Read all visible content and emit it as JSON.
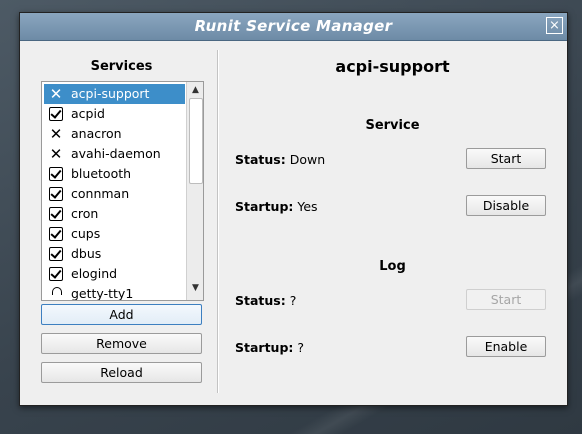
{
  "window": {
    "title": "Runit Service Manager",
    "close_glyph": "⨯"
  },
  "left": {
    "heading": "Services",
    "items": [
      {
        "label": "acpi-support",
        "state": "disabled",
        "selected": true
      },
      {
        "label": "acpid",
        "state": "enabled"
      },
      {
        "label": "anacron",
        "state": "disabled"
      },
      {
        "label": "avahi-daemon",
        "state": "disabled"
      },
      {
        "label": "bluetooth",
        "state": "enabled"
      },
      {
        "label": "connman",
        "state": "enabled"
      },
      {
        "label": "cron",
        "state": "enabled"
      },
      {
        "label": "cups",
        "state": "enabled"
      },
      {
        "label": "dbus",
        "state": "enabled"
      },
      {
        "label": "elogind",
        "state": "enabled"
      },
      {
        "label": "getty-tty1",
        "state": "locked"
      }
    ],
    "buttons": {
      "add": "Add",
      "remove": "Remove",
      "reload": "Reload"
    }
  },
  "detail": {
    "service_name": "acpi-support",
    "service": {
      "heading": "Service",
      "status_key": "Status:",
      "status_value": "Down",
      "startup_key": "Startup:",
      "startup_value": "Yes",
      "start_btn": "Start",
      "toggle_btn": "Disable"
    },
    "log": {
      "heading": "Log",
      "status_key": "Status:",
      "status_value": "?",
      "startup_key": "Startup:",
      "startup_value": "?",
      "start_btn": "Start",
      "toggle_btn": "Enable"
    }
  }
}
